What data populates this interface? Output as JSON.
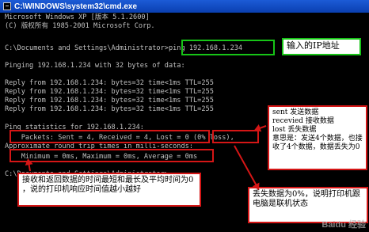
{
  "window": {
    "title": "C:\\WINDOWS\\system32\\cmd.exe"
  },
  "console": {
    "lines": [
      "Microsoft Windows XP [版本 5.1.2600]",
      "(C) 版权所有 1985-2001 Microsoft Corp.",
      "",
      "C:\\Documents and Settings\\Administrator>ping 192.168.1.234",
      "",
      "Pinging 192.168.1.234 with 32 bytes of data:",
      "",
      "Reply from 192.168.1.234: bytes=32 time<1ms TTL=255",
      "Reply from 192.168.1.234: bytes=32 time<1ms TTL=255",
      "Reply from 192.168.1.234: bytes=32 time<1ms TTL=255",
      "Reply from 192.168.1.234: bytes=32 time<1ms TTL=255",
      "",
      "Ping statistics for 192.168.1.234:",
      "    Packets: Sent = 4, Received = 4, Lost = 0 (0% loss),",
      "Approximate round trip times in milli-seconds:",
      "    Minimum = 0ms, Maximum = 0ms, Average = 0ms",
      "",
      "C:\\Documents and Settings\\Administrator>"
    ]
  },
  "annotations": {
    "ip_input": "输入的IP地址",
    "packets_note": "sent 发送数据\nrecevied 接收数据\nlost 丢失数据\n意思是：发送4个数据，也接收了4个数据，数据丢失为0",
    "times_note": "接收和返回数据的时间最短和最长及平均时间为0 ，说的打印机响应时间值越小越好",
    "loss_note": "丢失数据为0%，说明打印机跟电脑是联机状态"
  },
  "watermark": "Baidu 经验"
}
